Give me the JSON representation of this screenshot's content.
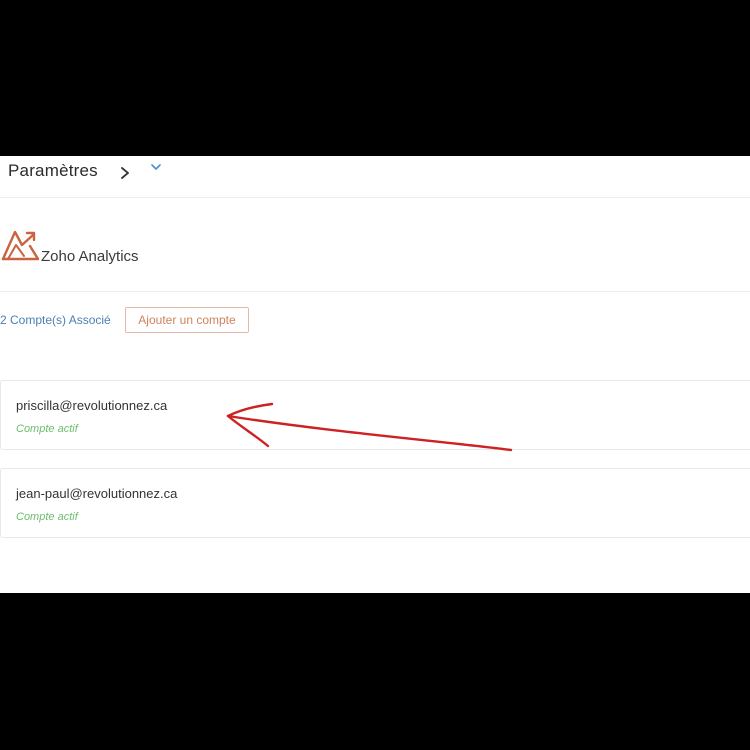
{
  "header": {
    "title": "Paramètres",
    "chevron_right_icon": "chevron-right-icon",
    "chevron_down_icon": "chevron-down-icon"
  },
  "app": {
    "name": "Zoho Analytics",
    "logo_icon": "zoho-analytics-logo",
    "logo_color": "#c9643e"
  },
  "accounts": {
    "count_label": "2 Compte(s) Associé",
    "add_button_label": "Ajouter un compte",
    "items": [
      {
        "email": "priscilla@revolutionnez.ca",
        "status": "Compte actif"
      },
      {
        "email": "jean-paul@revolutionnez.ca",
        "status": "Compte actif"
      }
    ]
  },
  "colors": {
    "link_blue": "#4a7fb5",
    "accent_orange": "#d0825f",
    "status_green": "#6cbf6c",
    "annotation_red": "#cc2222"
  }
}
